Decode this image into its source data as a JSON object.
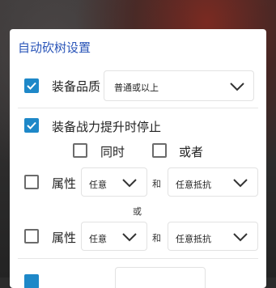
{
  "dialog": {
    "title": "自动砍树设置",
    "equipment_quality": {
      "label": "装备品质",
      "checked": true,
      "selected": "普通或以上"
    },
    "stop_on_power": {
      "label": "装备战力提升时停止",
      "checked": true
    },
    "same_time": {
      "label": "同时",
      "checked": false
    },
    "or_option": {
      "label": "或者",
      "checked": false
    },
    "attr_row1": {
      "label": "属性",
      "checked": false,
      "select1": "任意",
      "conj": "和",
      "select2": "任意抵抗"
    },
    "or_separator": "或",
    "attr_row2": {
      "label": "属性",
      "checked": false,
      "select1": "任意",
      "conj": "和",
      "select2": "任意抵抗"
    }
  },
  "colors": {
    "accent": "#1e88c8",
    "title": "#2a55b8"
  },
  "icons": {
    "check": "check-icon",
    "dropdown": "chevron-down-icon"
  }
}
